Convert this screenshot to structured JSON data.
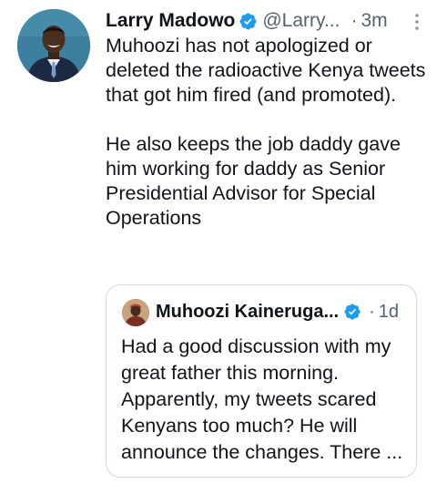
{
  "tweet": {
    "author_name": "Larry Madowo",
    "handle": "@Larry...",
    "separator": "·",
    "timestamp": "3m",
    "paragraphs": [
      "Muhoozi has not apologized or deleted the radioactive Kenya tweets that got him fired (and promoted).",
      "He also keeps the job daddy gave him working for daddy as Senior Presidential Advisor for Special Operations"
    ],
    "avatar_icon": "profile-photo",
    "verified_icon": "verified-badge-icon",
    "more_icon": "more-vertical-icon"
  },
  "quoted_tweet": {
    "author_name": "Muhoozi Kaineruga...",
    "separator": "·",
    "timestamp": "1d",
    "text": "Had a good discussion with my great father this morning. Apparently, my tweets scared Kenyans too much? He will announce the changes. There ...",
    "verified_icon": "verified-badge-icon"
  },
  "colors": {
    "text_primary": "#0f1419",
    "text_secondary": "#536471",
    "verified_blue": "#1d9bf0",
    "card_border": "#cfd9de"
  }
}
